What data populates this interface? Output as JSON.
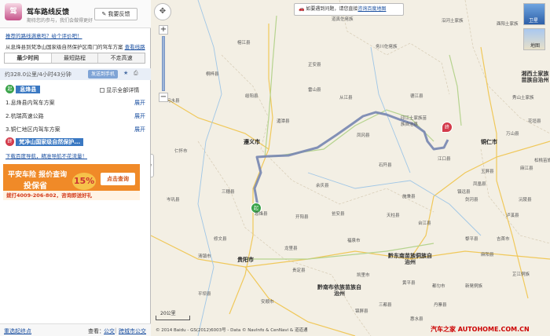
{
  "feedback": {
    "logo_text": "驾",
    "title": "驾车路线反馈",
    "subtitle": "期待您的参与，我们会做得更好",
    "button": "我要反馈"
  },
  "survey_link": "推荐的路线满意吗？给个评价吧！",
  "route_desc": {
    "text": "从息烽县到梵净山国家级自然保护区南门的驾车方案",
    "link": "查看线路"
  },
  "tabs": [
    {
      "label": "最少时间",
      "active": true
    },
    {
      "label": "最短路程",
      "active": false
    },
    {
      "label": "不走高速",
      "active": false
    }
  ],
  "summary": {
    "text": "约328.0公里/4小时43分钟",
    "send_button": "发送到手机"
  },
  "start": {
    "badge": "起",
    "name": "息烽县",
    "show_all": "显示全部详情"
  },
  "steps": [
    {
      "text": "1.息烽县内驾车方案",
      "action": "展开"
    },
    {
      "text": "2.杭瑞高速公路",
      "action": "展开"
    },
    {
      "text": "3.铜仁地区内驾车方案",
      "action": "展开"
    }
  ],
  "end": {
    "badge": "终",
    "name": "梵净山国家级自然保护..."
  },
  "links": "下载百度导航，精准导航不花流量！",
  "ad": {
    "line1": "平安车险 报价查询",
    "line2": "投保省",
    "pct": "15%",
    "cta": "点击查询",
    "bottom": "拨打4009-206-802，咨询即送好礼"
  },
  "footer": {
    "left": "重选起终点",
    "label": "查看：",
    "link1": "公交",
    "link2": "跨城市公交"
  },
  "map": {
    "notice": "如要遇到问题，请您直接",
    "notice_link": "咨询百度地图",
    "map_type_label": "地图",
    "sat_label": "卫星",
    "start_badge": "起",
    "end_badge": "终",
    "cities": [
      {
        "name": "遵义市",
        "cls": "city"
      },
      {
        "name": "贵阳市",
        "cls": "city"
      },
      {
        "name": "铜仁市",
        "cls": "city"
      },
      {
        "name": "黔东南苗族侗族自治州",
        "cls": "region"
      },
      {
        "name": "黔南布依族苗族自治州",
        "cls": "region"
      },
      {
        "name": "湘西土家族苗族自治州",
        "cls": "region"
      },
      {
        "name": "印江土家族苗族自治县",
        "cls": "county"
      }
    ],
    "counties": [
      "道真仡佬族",
      "正安县",
      "务川仡佬族",
      "沿河土家族",
      "酉阳土家族",
      "秀山土家族",
      "桐梓县",
      "绥阳县",
      "凤冈县",
      "德江县",
      "湄潭县",
      "余庆县",
      "石阡县",
      "江口县",
      "习水县",
      "仁怀市",
      "息烽县",
      "开阳县",
      "瓮安县",
      "施秉县",
      "镇远县",
      "修文县",
      "清镇市",
      "龙里县",
      "贵定县",
      "福泉市",
      "凯里市",
      "黄平县",
      "平坝县",
      "安顺市",
      "惠水县",
      "三都县",
      "都匀市",
      "丹寨县",
      "麻江县",
      "凤凰县",
      "玉屏县",
      "万山县",
      "松桃苗族",
      "花垣县",
      "吉首市",
      "沅陵县",
      "泸溪县",
      "麻阳县",
      "芷江侗族",
      "新晃侗族",
      "天柱县",
      "锦屏县",
      "黎平县",
      "剑河县",
      "台江县",
      "雷山县",
      "榕江县",
      "从江县",
      "岑巩县",
      "三穗县"
    ],
    "copyright": "© 2014 Baidu - GS(2012)6003号 - Data © NavInfo & CenNavi & 道道通",
    "watermark": "汽车之家  AUTOHOME.COM.CN",
    "scale": "20公里"
  }
}
